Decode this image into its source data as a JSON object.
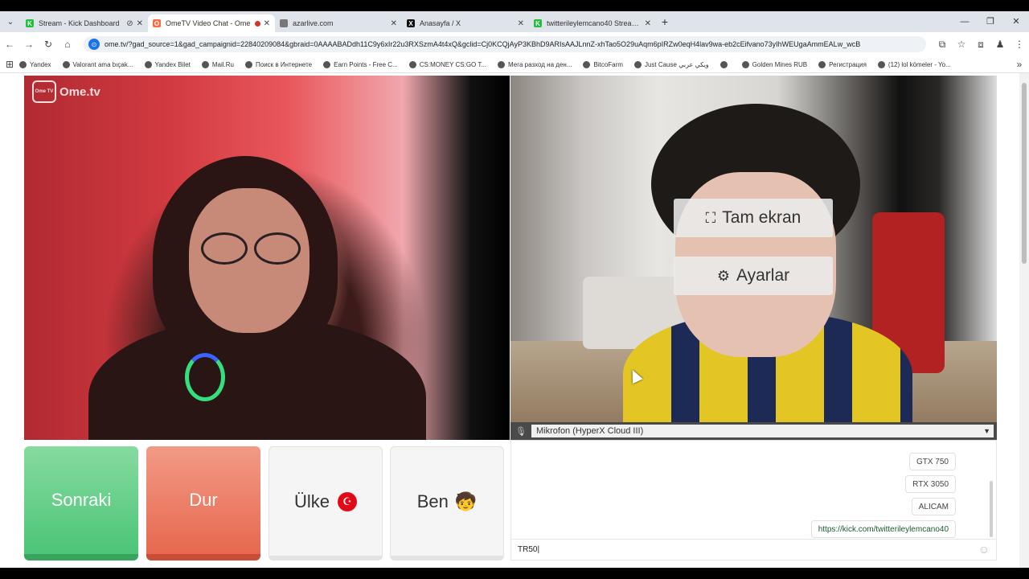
{
  "browser": {
    "tabs": [
      {
        "title": "Stream - Kick Dashboard",
        "favicon_color": "#1fbf3a",
        "favicon_glyph": "K"
      },
      {
        "title": "OmeTV Video Chat - Ome",
        "favicon_color": "#ff6a3d",
        "favicon_glyph": "O",
        "active": true
      },
      {
        "title": "azarlive.com",
        "favicon_color": "#777777",
        "favicon_glyph": ""
      },
      {
        "title": "Anasayfa / X",
        "favicon_color": "#111111",
        "favicon_glyph": "X"
      },
      {
        "title": "twitterileylemcano40 Stream - K",
        "favicon_color": "#1fbf3a",
        "favicon_glyph": "K"
      }
    ],
    "url": "ome.tv/?gad_source=1&gad_campaignid=22840209084&gbraid=0AAAABADdh11C9y6xIr22u3RXSzmA4t4xQ&gclid=Cj0KCQjAyP3KBhD9ARIsAAJLnnZ-xhTao5O29uAqm6pIRZw0eqH4lav9wa-eb2cEifvano73yIhWEUgaAmmEALw_wcB",
    "bookmarks": [
      "Yandex",
      "Valorant ama bıçak...",
      "Yandex Bilet",
      "Mail.Ru",
      "Поиск в Интернете",
      "Earn Points - Free C...",
      "CS:MONEY CS:GO T...",
      "Мега разход на ден...",
      "BitcoFarm",
      "Just Cause ويكي عربي",
      "",
      "Golden Mines RUB",
      "Регистрация",
      "(12) lol kömeler - Yo..."
    ]
  },
  "app": {
    "logo_text": "Ome.tv",
    "logo_badge": "Ome TV",
    "overlay": {
      "fullscreen_label": "Tam ekran",
      "settings_label": "Ayarlar"
    },
    "mic": {
      "selected": "Mikrofon (HyperX Cloud III)"
    },
    "buttons": {
      "next": "Sonraki",
      "stop": "Dur",
      "country": "Ülke",
      "me": "Ben",
      "country_flag": "☪",
      "me_emoji": "🧒"
    },
    "chat": {
      "messages": [
        "GTX 750",
        "RTX 3050",
        "ALICAM",
        "https://kick.com/twitterileylemcano40"
      ],
      "input_value": "TR50"
    }
  }
}
